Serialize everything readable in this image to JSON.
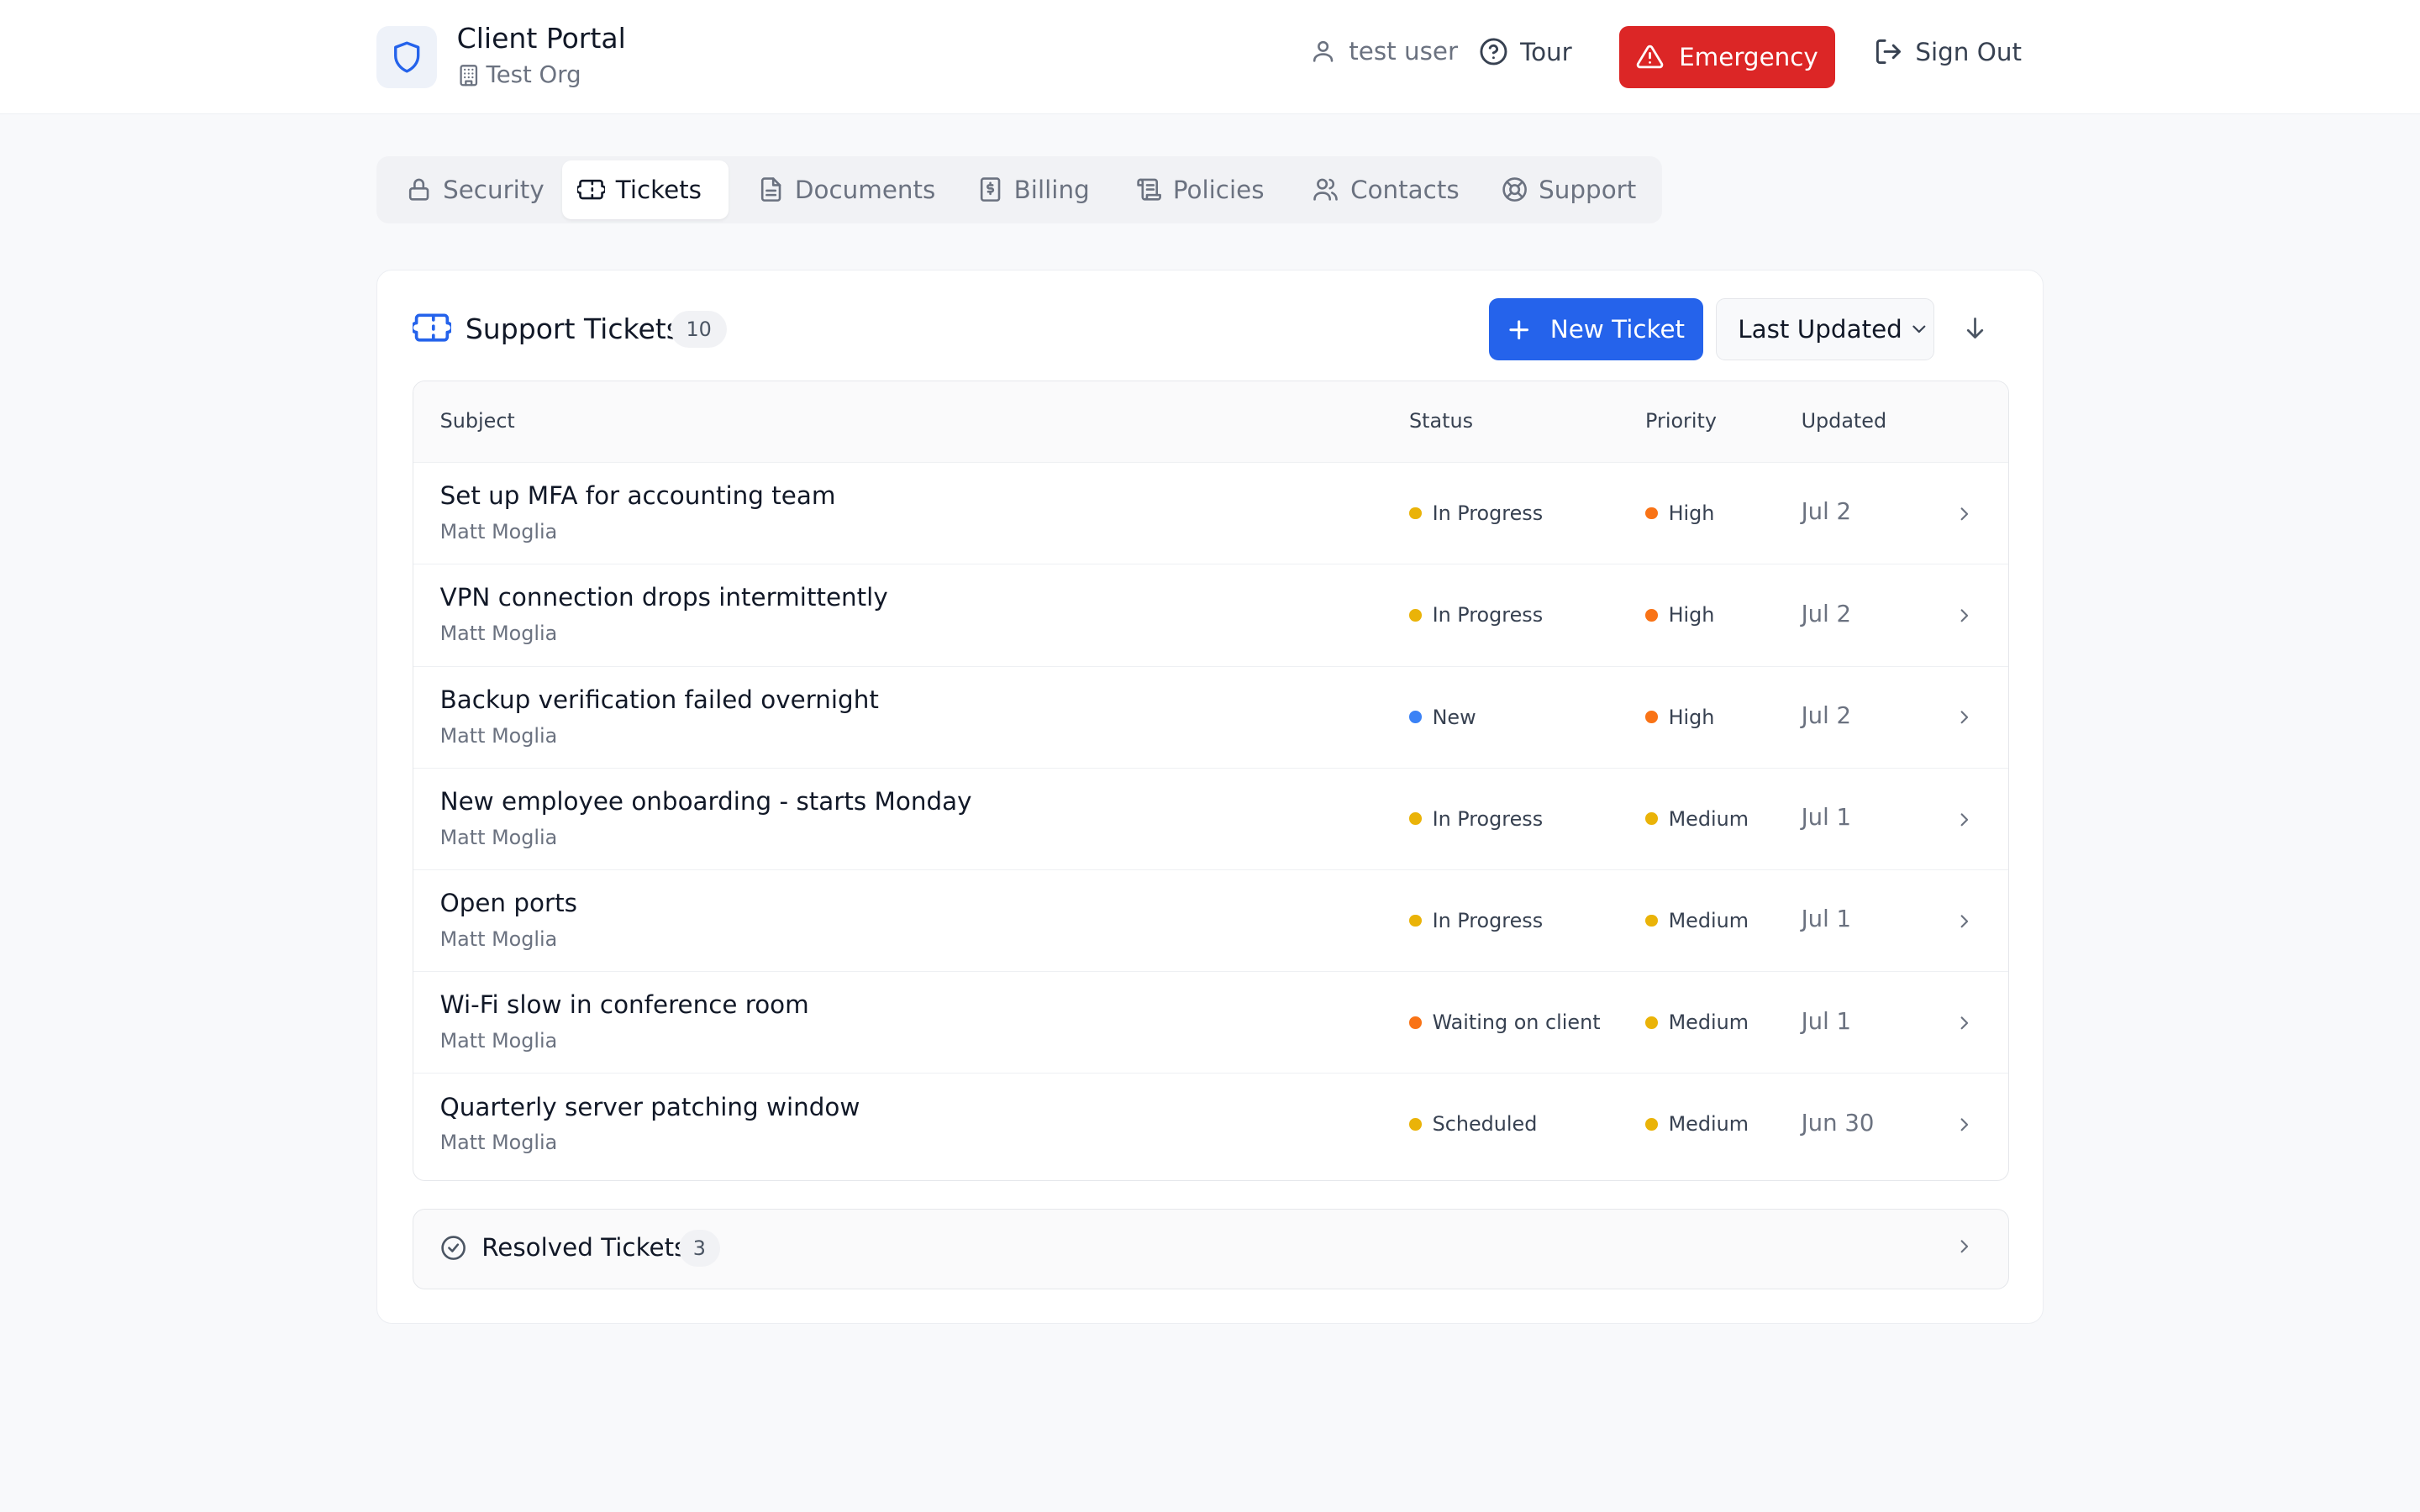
{
  "header": {
    "app_title": "Client Portal",
    "org_name": "Test Org",
    "user_name": "test user",
    "tour_label": "Tour",
    "emergency_label": "Emergency",
    "signout_label": "Sign Out"
  },
  "tabs": [
    {
      "label": "Security",
      "icon": "lock-icon",
      "active": false
    },
    {
      "label": "Tickets",
      "icon": "ticket-icon",
      "active": true
    },
    {
      "label": "Documents",
      "icon": "document-icon",
      "active": false
    },
    {
      "label": "Billing",
      "icon": "receipt-icon",
      "active": false
    },
    {
      "label": "Policies",
      "icon": "scroll-icon",
      "active": false
    },
    {
      "label": "Contacts",
      "icon": "users-icon",
      "active": false
    },
    {
      "label": "Support",
      "icon": "lifebuoy-icon",
      "active": false
    }
  ],
  "tickets": {
    "title": "Support Tickets",
    "count": "10",
    "new_label": "New Ticket",
    "sort_label": "Last Updated",
    "columns": {
      "subject": "Subject",
      "status": "Status",
      "priority": "Priority",
      "updated": "Updated"
    },
    "rows": [
      {
        "subject": "Set up MFA for accounting team",
        "author": "Matt Moglia",
        "status": "In Progress",
        "priority": "High",
        "updated": "Jul 2"
      },
      {
        "subject": "VPN connection drops intermittently",
        "author": "Matt Moglia",
        "status": "In Progress",
        "priority": "High",
        "updated": "Jul 2"
      },
      {
        "subject": "Backup verification failed overnight",
        "author": "Matt Moglia",
        "status": "New",
        "priority": "High",
        "updated": "Jul 2"
      },
      {
        "subject": "New employee onboarding - starts Monday",
        "author": "Matt Moglia",
        "status": "In Progress",
        "priority": "Medium",
        "updated": "Jul 1"
      },
      {
        "subject": "Open ports",
        "author": "Matt Moglia",
        "status": "In Progress",
        "priority": "Medium",
        "updated": "Jul 1"
      },
      {
        "subject": "Wi-Fi slow in conference room",
        "author": "Matt Moglia",
        "status": "Waiting on client",
        "priority": "Medium",
        "updated": "Jul 1"
      },
      {
        "subject": "Quarterly server patching window",
        "author": "Matt Moglia",
        "status": "Scheduled",
        "priority": "Medium",
        "updated": "Jun 30"
      }
    ],
    "resolved_label": "Resolved Tickets",
    "resolved_count": "3"
  },
  "colors": {
    "primary": "#2563eb",
    "emergency": "#dc2626",
    "status_in_progress": "#eab308",
    "status_new": "#3b82f6",
    "status_waiting": "#f97316",
    "status_scheduled": "#eab308",
    "priority_high": "#f97316",
    "priority_medium": "#eab308"
  }
}
